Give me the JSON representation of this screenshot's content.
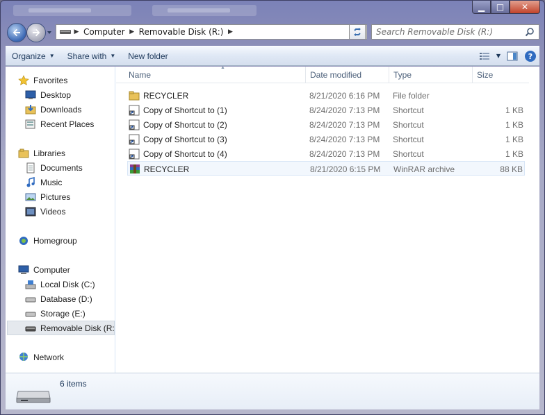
{
  "window": {
    "caption": {
      "minimize": "▁",
      "maximize": "□",
      "close": "✕"
    }
  },
  "navigation": {
    "breadcrumb": [
      "Computer",
      "Removable Disk (R:)"
    ],
    "search_placeholder": "Search Removable Disk (R:)"
  },
  "toolbar": {
    "organize_label": "Organize",
    "share_label": "Share with",
    "new_folder_label": "New folder"
  },
  "sidebar": {
    "favorites": {
      "label": "Favorites",
      "items": [
        "Desktop",
        "Downloads",
        "Recent Places"
      ]
    },
    "libraries": {
      "label": "Libraries",
      "items": [
        "Documents",
        "Music",
        "Pictures",
        "Videos"
      ]
    },
    "homegroup": {
      "label": "Homegroup"
    },
    "computer": {
      "label": "Computer",
      "items": [
        "Local Disk (C:)",
        "Database (D:)",
        "Storage (E:)",
        "Removable Disk (R:)"
      ]
    },
    "network": {
      "label": "Network"
    }
  },
  "file_list": {
    "columns": [
      "Name",
      "Date modified",
      "Type",
      "Size"
    ],
    "rows": [
      {
        "name": "RECYCLER",
        "date": "8/21/2020 6:16 PM",
        "type": "File folder",
        "size": "",
        "icon": "folder-icon"
      },
      {
        "name": "Copy of Shortcut to (1)",
        "date": "8/24/2020 7:13 PM",
        "type": "Shortcut",
        "size": "1 KB",
        "icon": "shortcut-icon"
      },
      {
        "name": "Copy of Shortcut to (2)",
        "date": "8/24/2020 7:13 PM",
        "type": "Shortcut",
        "size": "1 KB",
        "icon": "shortcut-icon"
      },
      {
        "name": "Copy of Shortcut to (3)",
        "date": "8/24/2020 7:13 PM",
        "type": "Shortcut",
        "size": "1 KB",
        "icon": "shortcut-icon"
      },
      {
        "name": "Copy of Shortcut to (4)",
        "date": "8/24/2020 7:13 PM",
        "type": "Shortcut",
        "size": "1 KB",
        "icon": "shortcut-icon"
      },
      {
        "name": "RECYCLER",
        "date": "8/21/2020 6:15 PM",
        "type": "WinRAR archive",
        "size": "88 KB",
        "icon": "winrar-archive-icon"
      }
    ]
  },
  "status": {
    "item_count": "6 items"
  }
}
